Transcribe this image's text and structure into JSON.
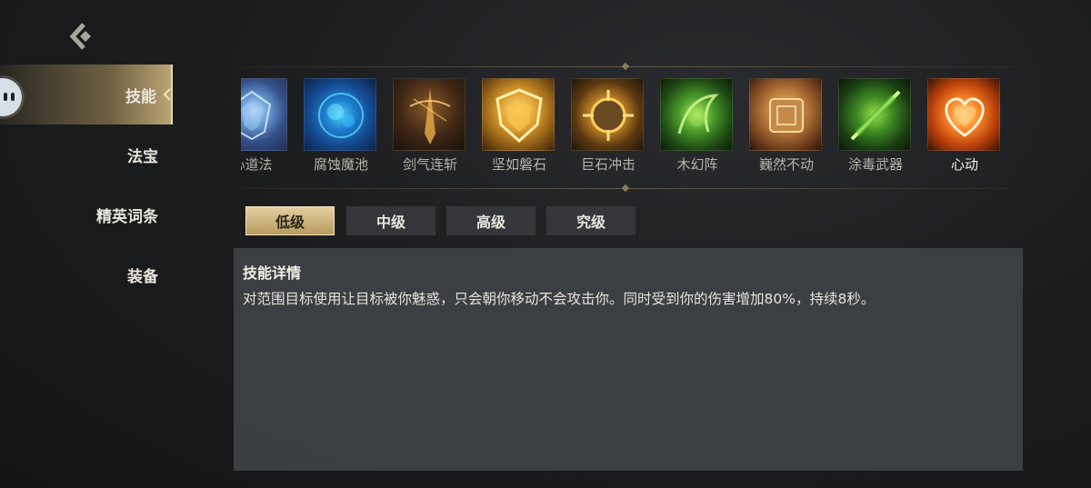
{
  "sidebar": {
    "items": [
      {
        "label": "技能"
      },
      {
        "label": "法宝"
      },
      {
        "label": "精英词条"
      },
      {
        "label": "装备"
      }
    ]
  },
  "skills": [
    {
      "name": "心道法",
      "icon": "blue-crystal-shield-icon"
    },
    {
      "name": "腐蚀魔池",
      "icon": "blue-corrosion-pool-icon"
    },
    {
      "name": "剑气连斩",
      "icon": "golden-sword-slash-icon"
    },
    {
      "name": "坚如磐石",
      "icon": "golden-shield-icon"
    },
    {
      "name": "巨石冲击",
      "icon": "boulder-impact-icon"
    },
    {
      "name": "木幻阵",
      "icon": "green-wood-array-icon"
    },
    {
      "name": "巍然不动",
      "icon": "stone-fortress-icon"
    },
    {
      "name": "涂毒武器",
      "icon": "poison-weapon-icon"
    },
    {
      "name": "心动",
      "icon": "orange-heart-icon"
    }
  ],
  "levels": [
    "低级",
    "中级",
    "高级",
    "究级"
  ],
  "detail": {
    "title": "技能详情",
    "description": "对范围目标使用让目标被你魅惑，只会朝你移动不会攻击你。同时受到你的伤害增加80%，持续8秒。"
  },
  "colors": {
    "accent_gold": "#d4bd8a",
    "panel": "#404348"
  }
}
